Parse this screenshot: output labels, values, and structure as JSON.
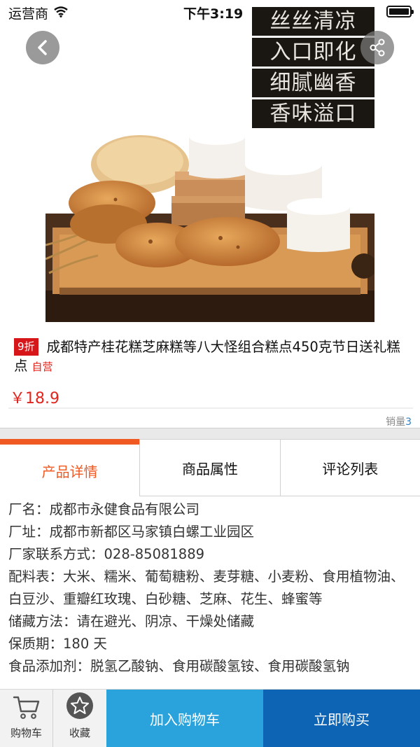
{
  "status_bar": {
    "carrier": "运营商",
    "time": "下午3:19"
  },
  "product": {
    "slogans": [
      "丝丝清凉",
      "入口即化",
      "细腻幽香",
      "香味溢口"
    ],
    "discount_badge": "9折",
    "title": "成都特产桂花糕芝麻糕等八大怪组合糕点450克节日送礼糕点",
    "self_operated": "自营",
    "price": "￥18.9",
    "sales_label": "销量",
    "sales_count": "3"
  },
  "tabs": [
    {
      "label": "产品详情",
      "active": true
    },
    {
      "label": "商品属性",
      "active": false
    },
    {
      "label": "评论列表",
      "active": false
    }
  ],
  "details": [
    "厂名：成都市永健食品有限公司",
    "厂址：成都市新都区马家镇白螺工业园区",
    "厂家联系方式：028-85081889",
    "配料表：大米、糯米、葡萄糖粉、麦芽糖、小麦粉、食用植物油、白豆沙、重瓣红玫瑰、白砂糖、芝麻、花生、蜂蜜等",
    "储藏方法：请在避光、阴凉、干燥处储藏",
    "保质期：180 天",
    "食品添加剂：脱氢乙酸钠、食用碳酸氢铵、食用碳酸氢钠"
  ],
  "bottom_bar": {
    "cart_label": "购物车",
    "favorite_label": "收藏",
    "add_to_cart_label": "加入购物车",
    "buy_now_label": "立即购买"
  },
  "colors": {
    "accent_orange": "#f05a22",
    "price_red": "#e0261e",
    "add_cart_blue": "#2aa3dc",
    "buy_now_blue": "#0d63b4"
  },
  "icons": [
    "wifi-icon",
    "battery-icon",
    "back-arrow-icon",
    "share-icon",
    "cart-icon",
    "star-icon"
  ]
}
